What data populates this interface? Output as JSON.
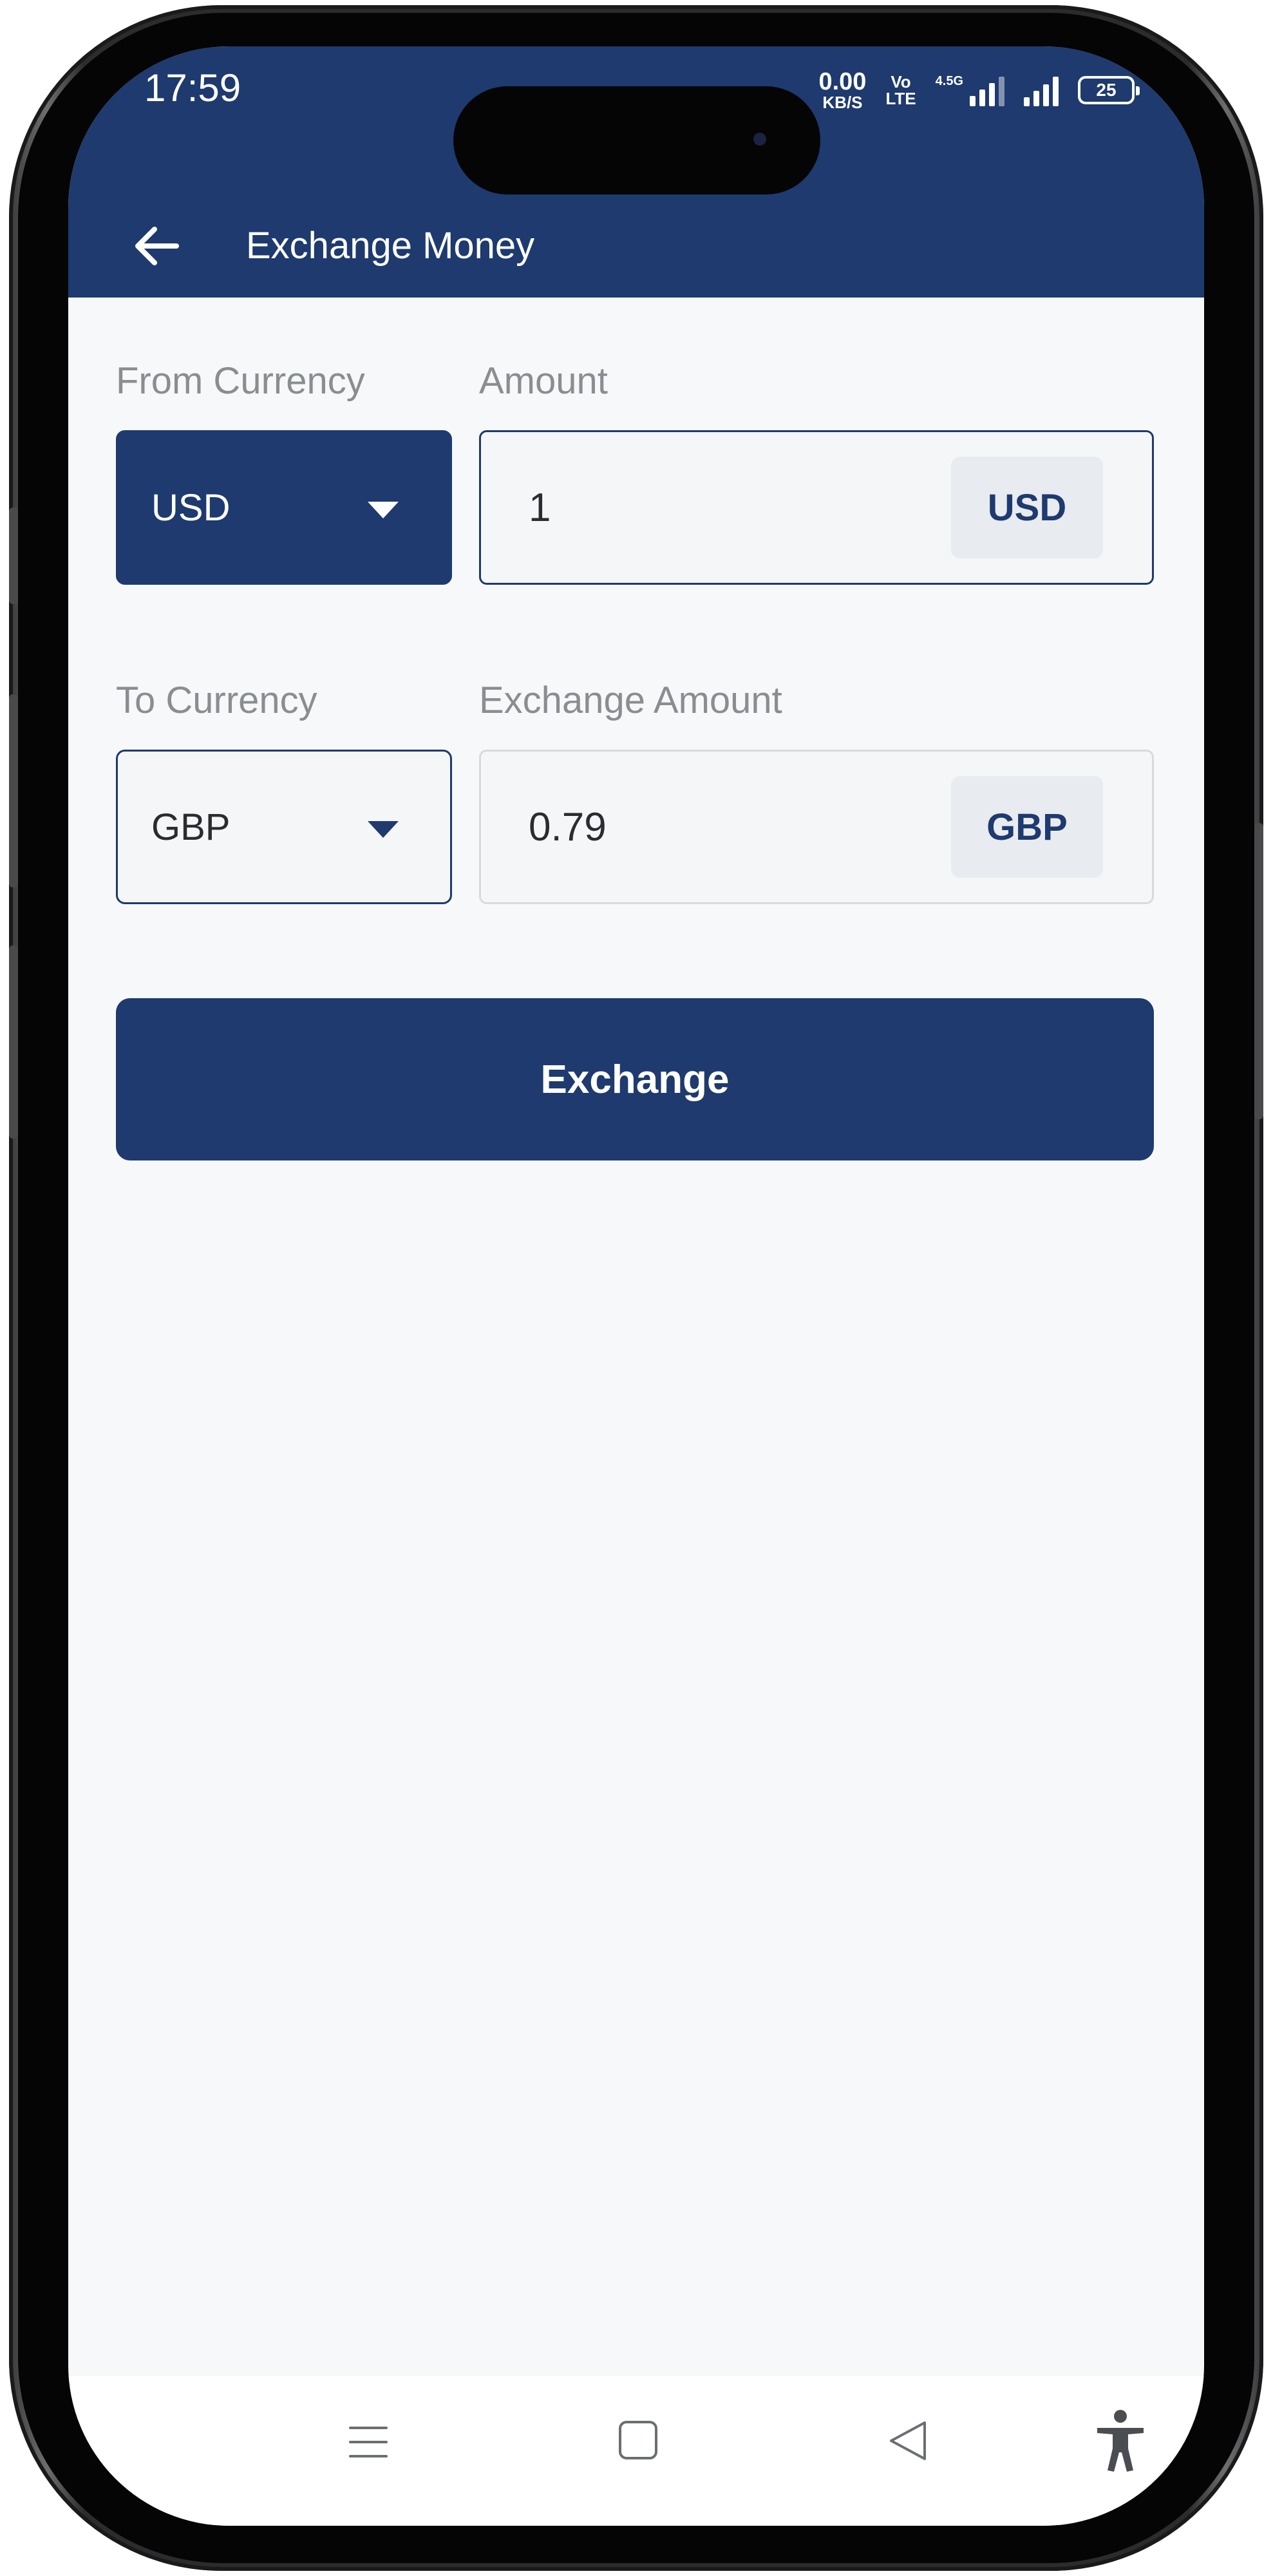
{
  "status_bar": {
    "time": "17:59",
    "net_speed_value": "0.00",
    "net_speed_unit": "KB/S",
    "volte_top": "Vo",
    "volte_bottom": "LTE",
    "signal_label": "4.5G",
    "battery": "25"
  },
  "header": {
    "title": "Exchange Money",
    "back_icon": "arrow-left-icon",
    "background": "#1e3a6e"
  },
  "from": {
    "label": "From Currency",
    "selected": "USD",
    "amount_label": "Amount",
    "amount_value": "1",
    "amount_unit": "USD"
  },
  "to": {
    "label": "To Currency",
    "selected": "GBP",
    "amount_label": "Exchange Amount",
    "amount_value": "0.79",
    "amount_unit": "GBP"
  },
  "actions": {
    "exchange_label": "Exchange"
  },
  "nav_bar": {
    "icons": [
      "menu-icon",
      "home-icon",
      "back-triangle-icon",
      "accessibility-icon"
    ]
  },
  "colors": {
    "primary": "#1e3a6e",
    "background": "#f7f8f9",
    "label": "#8a8d91"
  }
}
